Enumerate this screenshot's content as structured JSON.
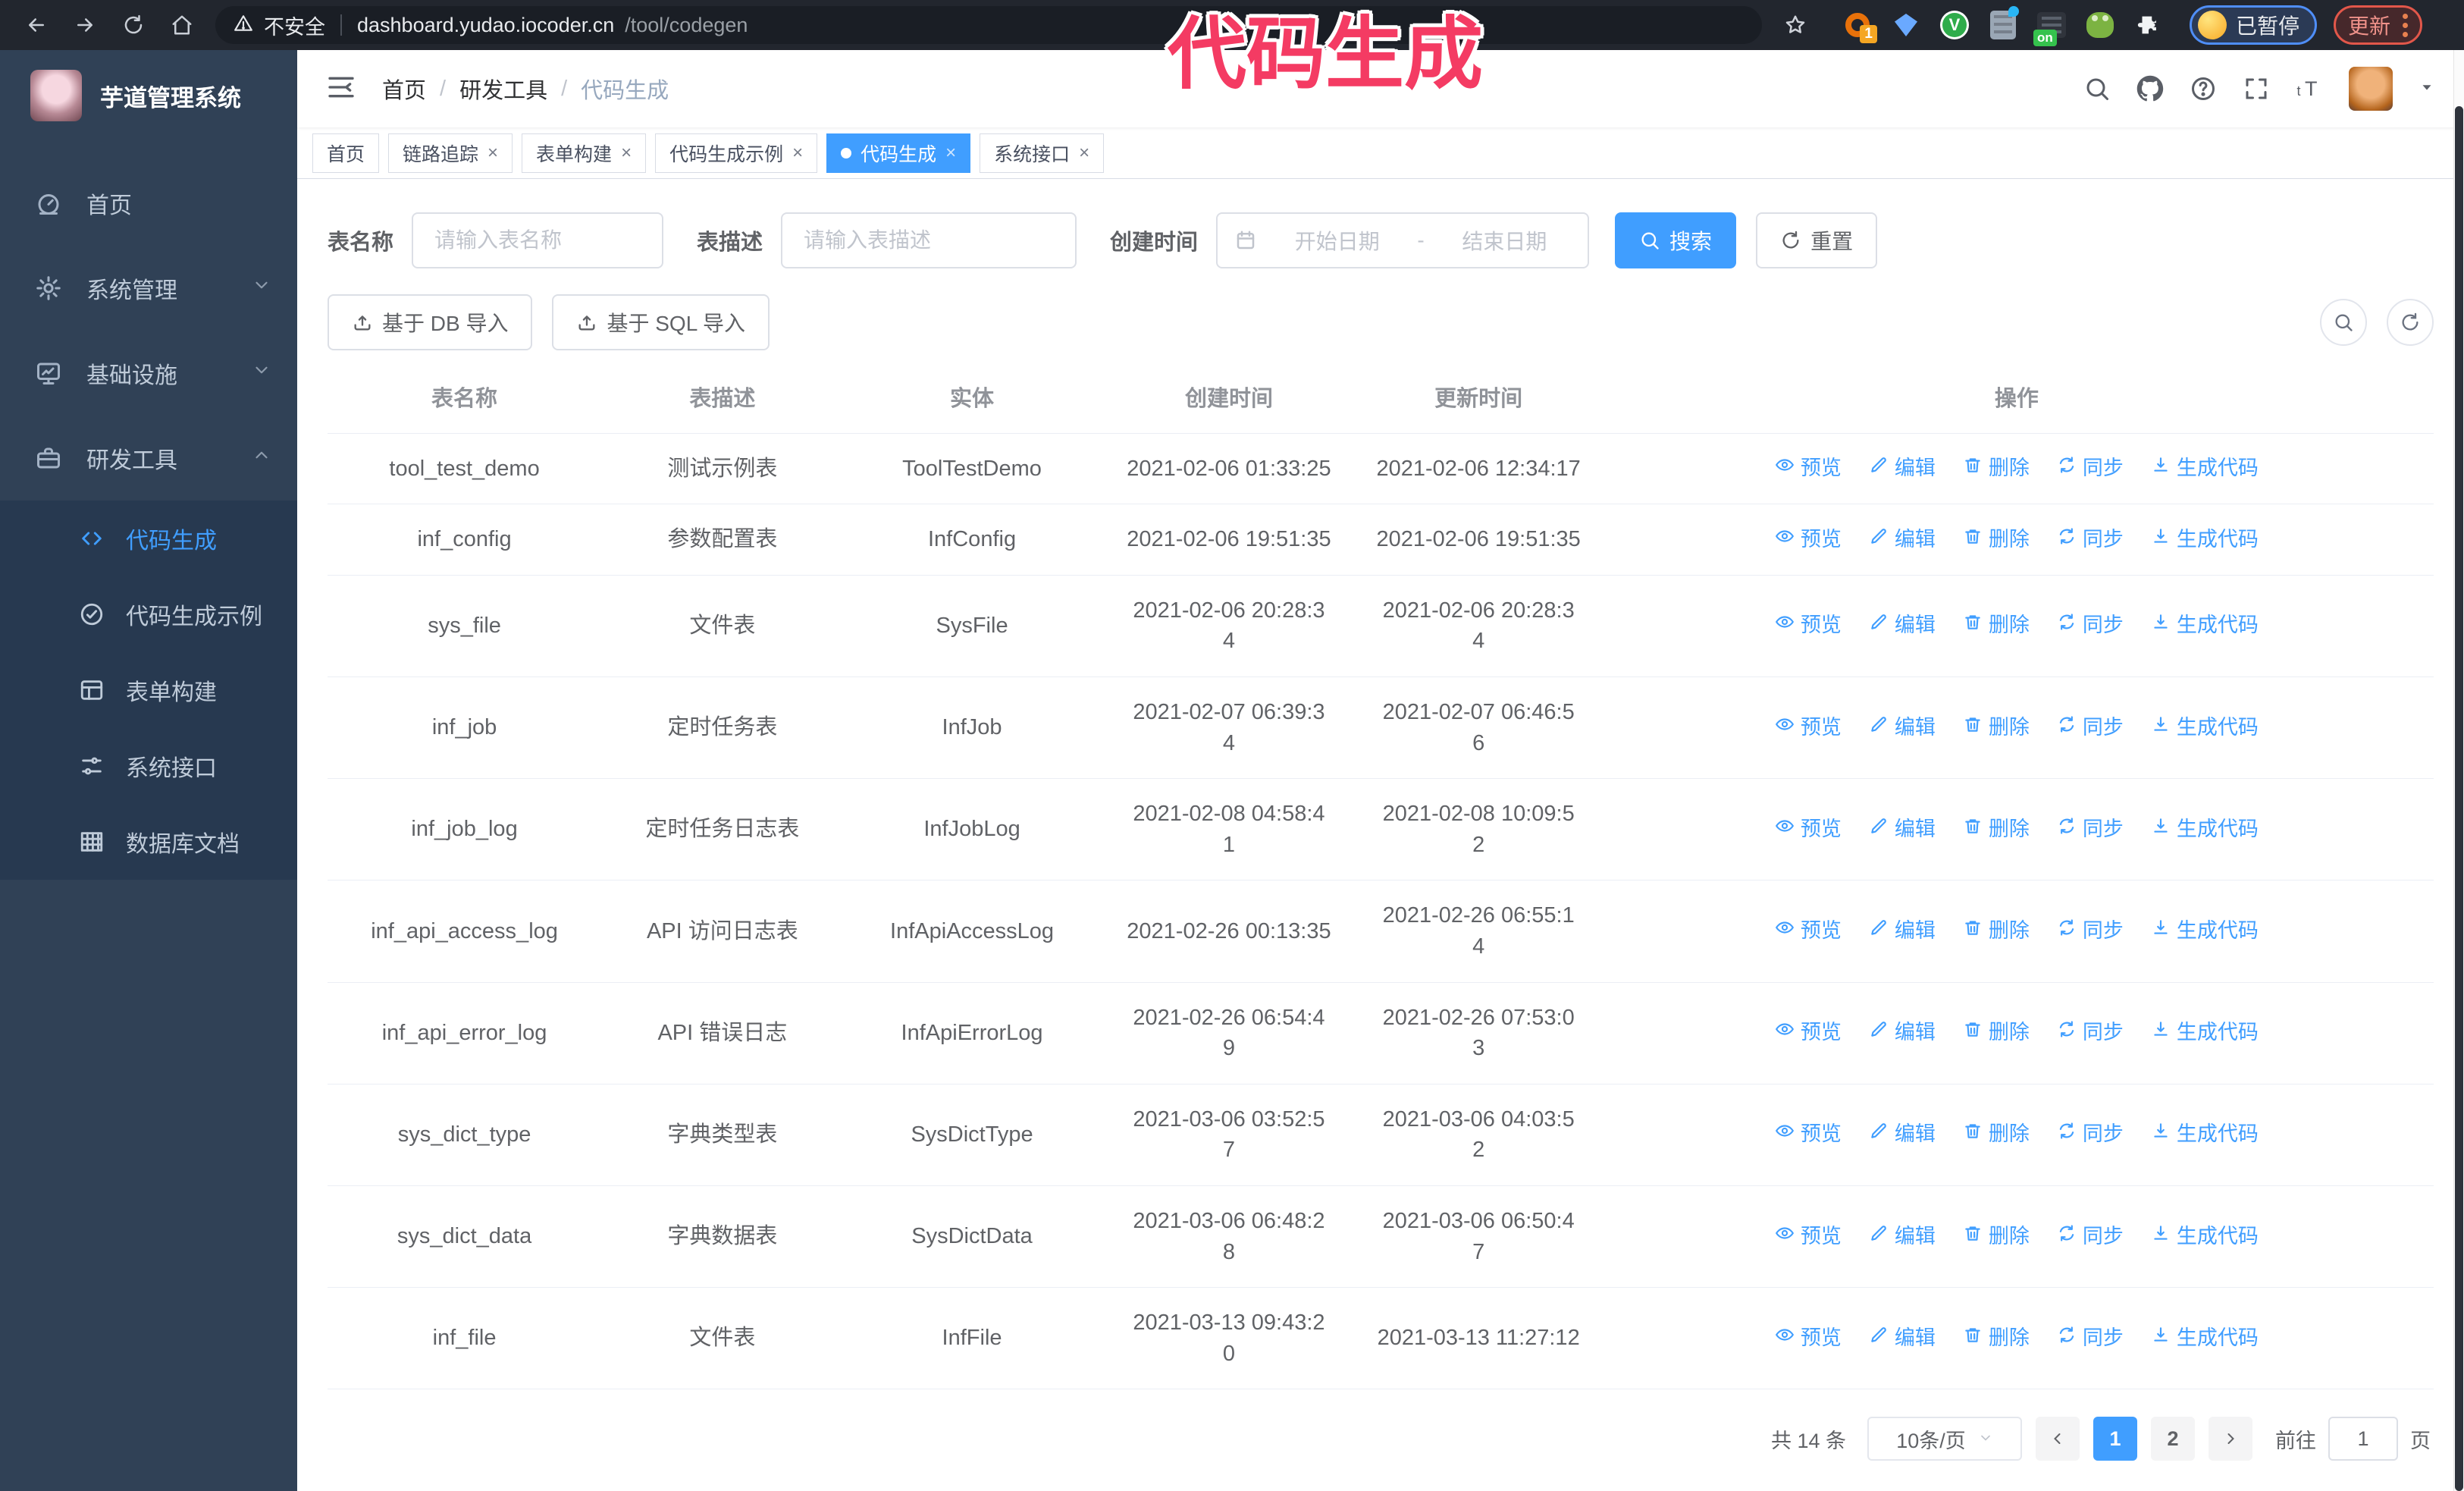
{
  "browser": {
    "security_label": "不安全",
    "url_host": "dashboard.yudao.iocoder.cn",
    "url_path": "/tool/codegen",
    "extension_badge": "1",
    "extension_on_badge": "on",
    "paused_badge": "已暂停",
    "update_button": "更新"
  },
  "overlay": {
    "text": "代码生成",
    "color": "#f43b63"
  },
  "sidebar": {
    "title": "芋道管理系统",
    "items": [
      {
        "key": "home",
        "label": "首页",
        "icon": "dashboard-icon",
        "chevron": null
      },
      {
        "key": "system",
        "label": "系统管理",
        "icon": "gear-icon",
        "chevron": "down"
      },
      {
        "key": "infra",
        "label": "基础设施",
        "icon": "monitor-icon",
        "chevron": "down"
      },
      {
        "key": "devtools",
        "label": "研发工具",
        "icon": "briefcase-icon",
        "chevron": "up",
        "expanded": true
      }
    ],
    "sub_items": [
      {
        "key": "codegen",
        "label": "代码生成",
        "icon": "code-icon",
        "active": true
      },
      {
        "key": "codegen-demo",
        "label": "代码生成示例",
        "icon": "check-circle-icon",
        "active": false
      },
      {
        "key": "form-builder",
        "label": "表单构建",
        "icon": "form-icon",
        "active": false
      },
      {
        "key": "system-api",
        "label": "系统接口",
        "icon": "sliders-icon",
        "active": false
      },
      {
        "key": "db-doc",
        "label": "数据库文档",
        "icon": "grid-icon",
        "active": false
      }
    ]
  },
  "header": {
    "breadcrumb": [
      "首页",
      "研发工具",
      "代码生成"
    ],
    "separator": "/"
  },
  "tabs": [
    {
      "key": "home",
      "label": "首页",
      "closable": false,
      "active": false
    },
    {
      "key": "tracing",
      "label": "链路追踪",
      "closable": true,
      "active": false
    },
    {
      "key": "form-builder",
      "label": "表单构建",
      "closable": true,
      "active": false
    },
    {
      "key": "codegen-demo",
      "label": "代码生成示例",
      "closable": true,
      "active": false
    },
    {
      "key": "codegen",
      "label": "代码生成",
      "closable": true,
      "active": true
    },
    {
      "key": "system-api",
      "label": "系统接口",
      "closable": true,
      "active": false
    }
  ],
  "filters": {
    "name_label": "表名称",
    "name_placeholder": "请输入表名称",
    "desc_label": "表描述",
    "desc_placeholder": "请输入表描述",
    "date_label": "创建时间",
    "date_start_placeholder": "开始日期",
    "date_separator": "-",
    "date_end_placeholder": "结束日期",
    "search_button": "搜索",
    "reset_button": "重置"
  },
  "toolbar": {
    "import_db": "基于 DB 导入",
    "import_sql": "基于 SQL 导入"
  },
  "table": {
    "columns": [
      "表名称",
      "表描述",
      "实体",
      "创建时间",
      "更新时间",
      "操作"
    ],
    "operations": [
      {
        "key": "preview",
        "label": "预览",
        "icon": "eye-icon"
      },
      {
        "key": "edit",
        "label": "编辑",
        "icon": "edit-icon"
      },
      {
        "key": "delete",
        "label": "删除",
        "icon": "trash-icon"
      },
      {
        "key": "sync",
        "label": "同步",
        "icon": "sync-icon"
      },
      {
        "key": "generate",
        "label": "生成代码",
        "icon": "download-icon"
      }
    ],
    "rows": [
      {
        "name": "tool_test_demo",
        "desc": "测试示例表",
        "entity": "ToolTestDemo",
        "created": "2021-02-06 01:33:25",
        "updated": "2021-02-06 12:34:17"
      },
      {
        "name": "inf_config",
        "desc": "参数配置表",
        "entity": "InfConfig",
        "created": "2021-02-06 19:51:35",
        "updated": "2021-02-06 19:51:35"
      },
      {
        "name": "sys_file",
        "desc": "文件表",
        "entity": "SysFile",
        "created": "2021-02-06 20:28:3\n4",
        "updated": "2021-02-06 20:28:3\n4"
      },
      {
        "name": "inf_job",
        "desc": "定时任务表",
        "entity": "InfJob",
        "created": "2021-02-07 06:39:3\n4",
        "updated": "2021-02-07 06:46:5\n6"
      },
      {
        "name": "inf_job_log",
        "desc": "定时任务日志表",
        "entity": "InfJobLog",
        "created": "2021-02-08 04:58:4\n1",
        "updated": "2021-02-08 10:09:5\n2"
      },
      {
        "name": "inf_api_access_log",
        "desc": "API 访问日志表",
        "entity": "InfApiAccessLog",
        "created": "2021-02-26 00:13:35",
        "updated": "2021-02-26 06:55:1\n4"
      },
      {
        "name": "inf_api_error_log",
        "desc": "API 错误日志",
        "entity": "InfApiErrorLog",
        "created": "2021-02-26 06:54:4\n9",
        "updated": "2021-02-26 07:53:0\n3"
      },
      {
        "name": "sys_dict_type",
        "desc": "字典类型表",
        "entity": "SysDictType",
        "created": "2021-03-06 03:52:5\n7",
        "updated": "2021-03-06 04:03:5\n2"
      },
      {
        "name": "sys_dict_data",
        "desc": "字典数据表",
        "entity": "SysDictData",
        "created": "2021-03-06 06:48:2\n8",
        "updated": "2021-03-06 06:50:4\n7"
      },
      {
        "name": "inf_file",
        "desc": "文件表",
        "entity": "InfFile",
        "created": "2021-03-13 09:43:2\n0",
        "updated": "2021-03-13 11:27:12"
      }
    ]
  },
  "pagination": {
    "total": "共 14 条",
    "page_size": "10条/页",
    "pages": [
      "1",
      "2"
    ],
    "active_page": "1",
    "goto_label": "前往",
    "goto_value": "1",
    "goto_suffix": "页"
  },
  "colors": {
    "accent": "#409EFF",
    "sidebar_bg": "#304156",
    "submenu_bg": "#273950",
    "overlay_pink": "#f43b63"
  }
}
